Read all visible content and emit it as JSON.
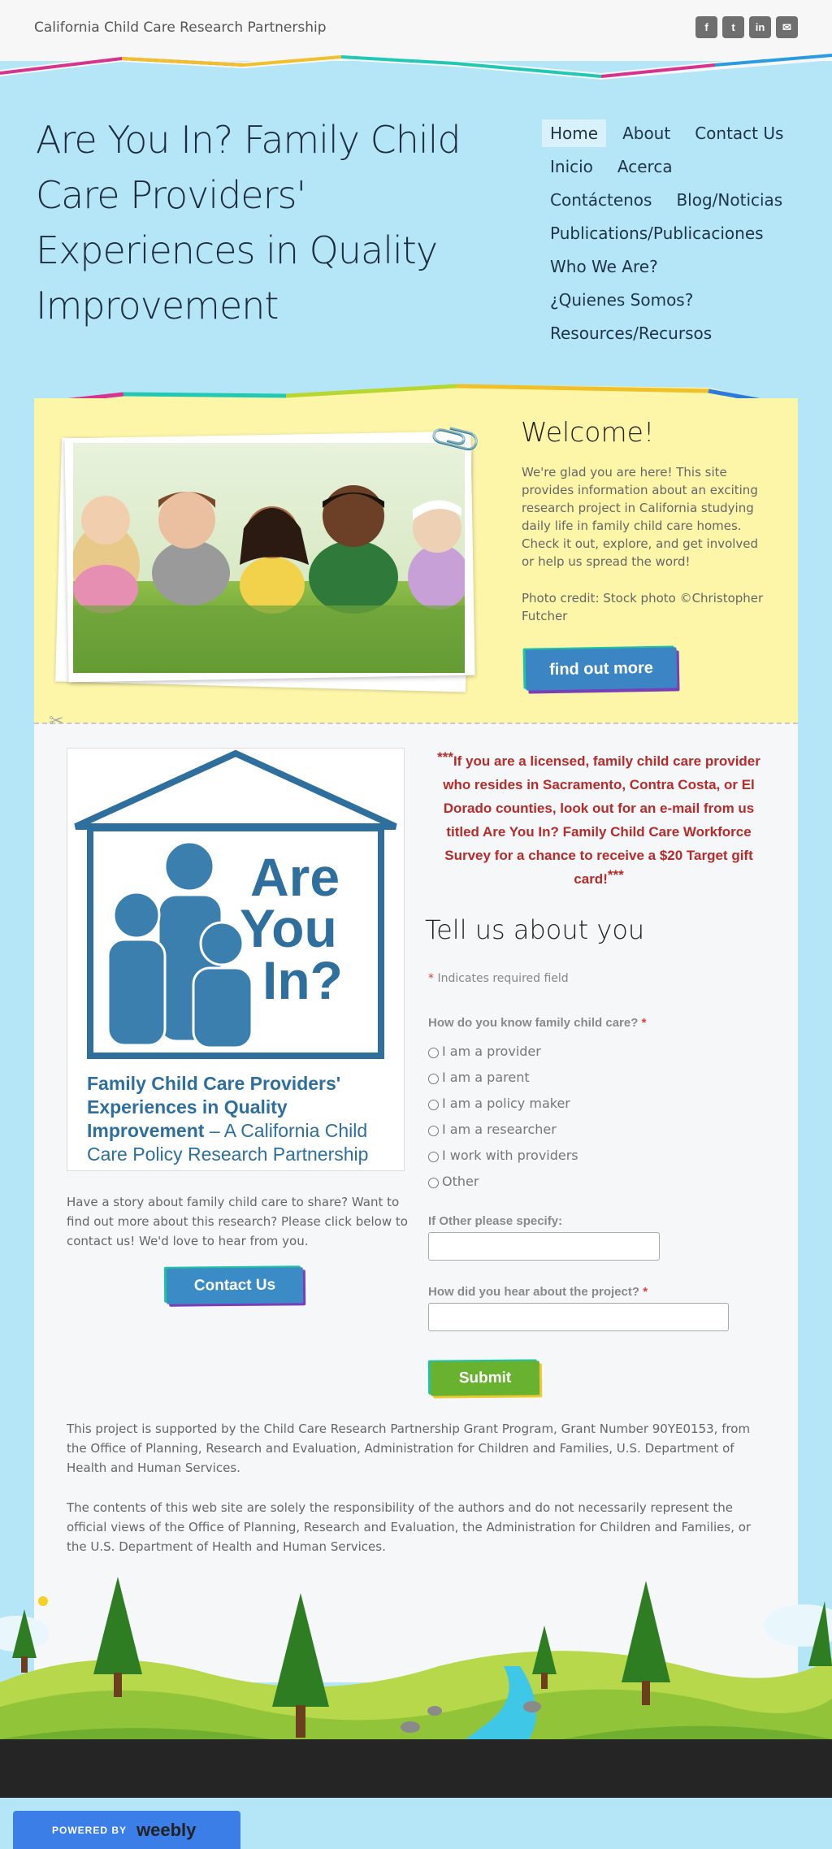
{
  "header": {
    "site_name": "California Child Care Research Partnership",
    "social": [
      {
        "icon": "facebook-icon",
        "glyph": "f"
      },
      {
        "icon": "twitter-icon",
        "glyph": "t"
      },
      {
        "icon": "linkedin-icon",
        "glyph": "in"
      },
      {
        "icon": "mail-icon",
        "glyph": "✉"
      }
    ]
  },
  "hero": {
    "title": "Are You In? Family Child Care Providers' Experiences in Quality Improvement"
  },
  "nav": {
    "items": [
      {
        "label": "Home",
        "active": true
      },
      {
        "label": "About"
      },
      {
        "label": "Contact Us"
      },
      {
        "label": "Inicio"
      },
      {
        "label": "Acerca"
      },
      {
        "label": "Contáctenos"
      },
      {
        "label": "Blog/Noticias"
      },
      {
        "label": "Publications/Publicaciones"
      },
      {
        "label": "Who We Are?"
      },
      {
        "label": "¿Quienes Somos?"
      },
      {
        "label": "Resources/Recursos"
      }
    ]
  },
  "welcome": {
    "title": "Welcome!",
    "text": "We're glad you are here!  This site provides information about an exciting research project in California studying daily life in family child care homes.  Check it out, explore, and get involved or help us spread the word!",
    "credit": "Photo credit: Stock photo ©Christopher Futcher",
    "button": "find out more"
  },
  "logo": {
    "line1": "Are",
    "line2": "You",
    "line3": "In?",
    "caption_bold": "Family Child Care Providers' Experiences in Quality Improvement",
    "caption_rest": " – A California Child Care Policy Research Partnership"
  },
  "story": {
    "text": "Have a story about family child care to share? Want to find out more about this research?  Please click below to contact us!  We'd love to hear from you.",
    "button": "Contact Us"
  },
  "notice": {
    "prefix": "***",
    "text": "If you are a licensed, family child care provider who resides in Sacramento, Contra Costa, or El Dorado counties, look out for an e-mail from us titled Are You In? Family Child Care Workforce Survey for a chance to receive a $20 Target gift card!",
    "suffix": "***"
  },
  "form": {
    "title": "Tell us about you",
    "required_star": "*",
    "required_note": "Indicates required field",
    "q1_label": "How do you know family child care?",
    "q1_options": [
      "I am a provider",
      "I am a parent",
      "I am a policy maker",
      "I am a researcher",
      "I work with providers",
      "Other"
    ],
    "other_label": "If Other please specify:",
    "other_value": "",
    "q2_label": "How did you hear about the project?",
    "q2_value": "",
    "submit": "Submit"
  },
  "footer": {
    "support": "This project is supported by the Child Care Research Partnership Grant Program, Grant Number 90YE0153, from the Office of Planning, Research and Evaluation, Administration for Children and Families, U.S. Department of Health and Human Services.",
    "disclaimer": "The contents of this web site are solely the responsibility of the authors and do not necessarily represent the official views of the Office of Planning, Research and Evaluation, the Administration for Children and Families, or the U.S. Department of Health and Human Services."
  },
  "badge": {
    "powered_by": "POWERED BY",
    "brand": "weebly"
  },
  "colors": {
    "sky": "#b4e6f7",
    "yellow_panel": "#fdf6a9",
    "notice_red": "#b72b2b",
    "button_blue": "#3b85c5",
    "submit_green": "#68b22f"
  }
}
